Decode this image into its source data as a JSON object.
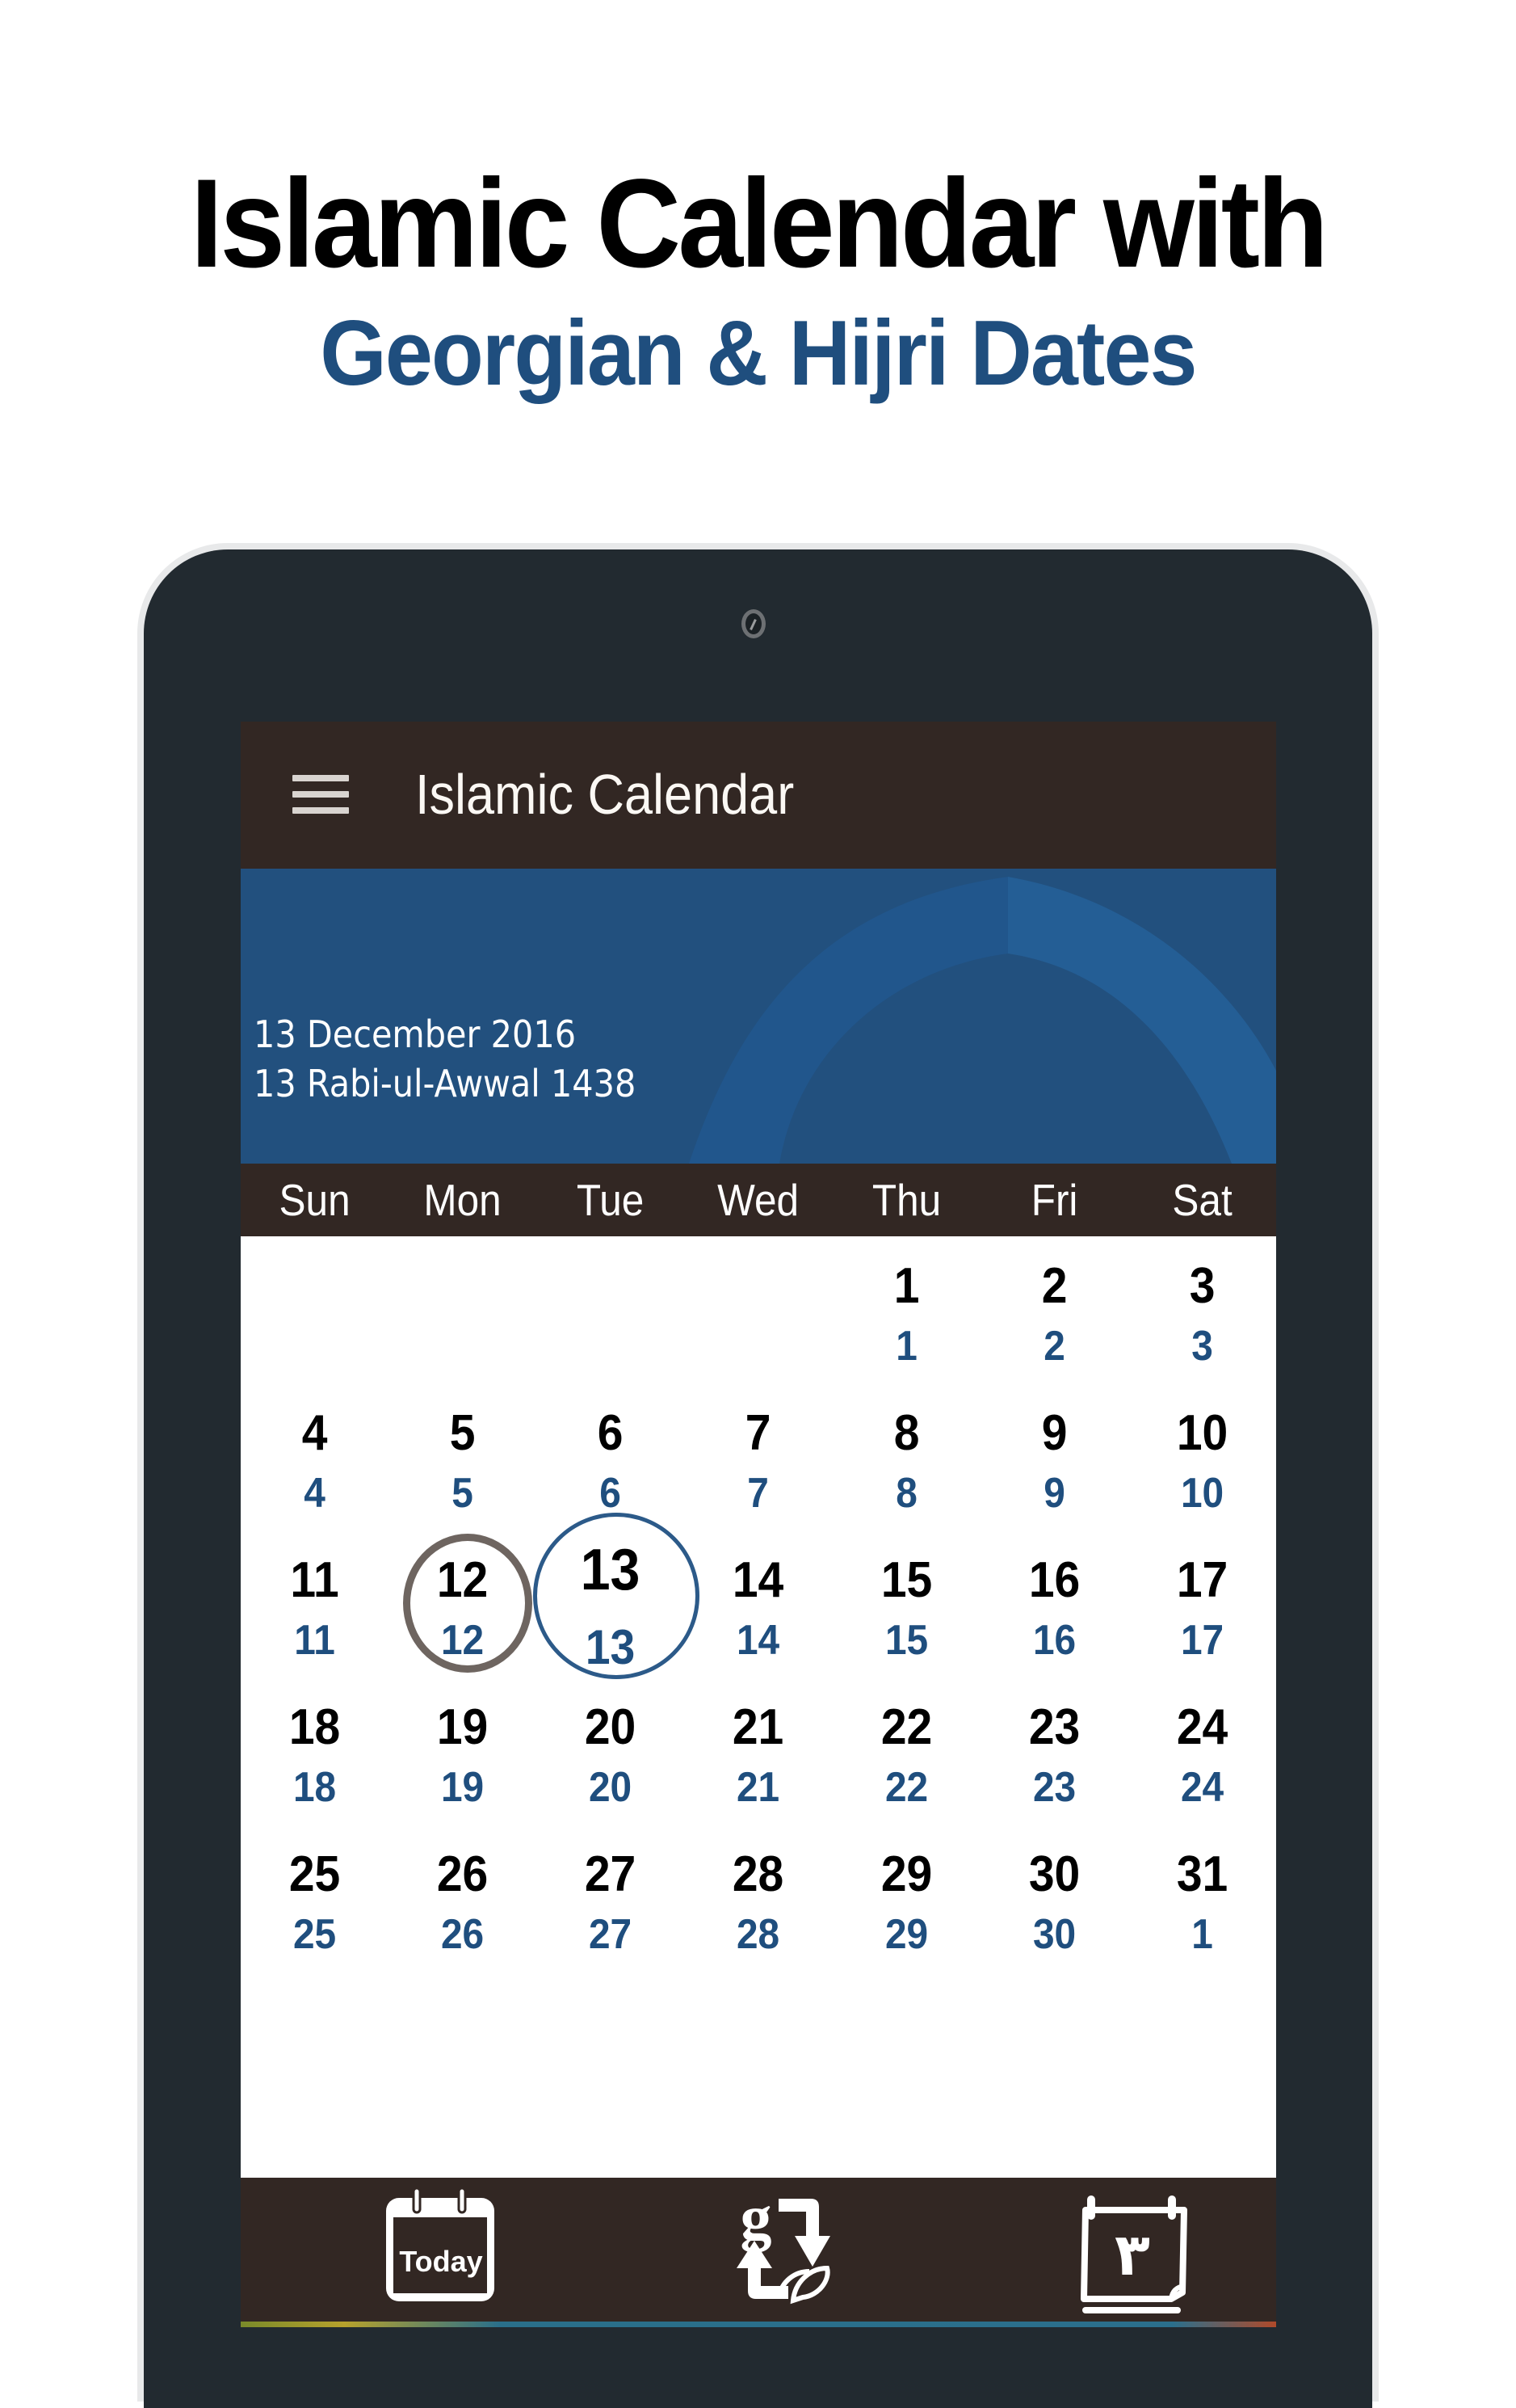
{
  "promo": {
    "headline": "Islamic Calendar with",
    "subheadline": "Georgian & Hijri Dates"
  },
  "app": {
    "title": "Islamic Calendar",
    "menu_icon": "hamburger-menu-icon"
  },
  "header": {
    "gregorian_date": "13 December 2016",
    "hijri_date": "13 Rabi-ul-Awwal 1438"
  },
  "calendar": {
    "weekdays": [
      "Sun",
      "Mon",
      "Tue",
      "Wed",
      "Thu",
      "Fri",
      "Sat"
    ],
    "today": {
      "gregorian": "13",
      "hijri": "13"
    },
    "selected": {
      "gregorian": "12",
      "hijri": "12"
    },
    "weeks": [
      [
        null,
        null,
        null,
        null,
        {
          "g": "1",
          "h": "1"
        },
        {
          "g": "2",
          "h": "2"
        },
        {
          "g": "3",
          "h": "3"
        }
      ],
      [
        {
          "g": "4",
          "h": "4"
        },
        {
          "g": "5",
          "h": "5"
        },
        {
          "g": "6",
          "h": "6"
        },
        {
          "g": "7",
          "h": "7"
        },
        {
          "g": "8",
          "h": "8"
        },
        {
          "g": "9",
          "h": "9"
        },
        {
          "g": "10",
          "h": "10"
        }
      ],
      [
        {
          "g": "11",
          "h": "11"
        },
        {
          "g": "12",
          "h": "12",
          "state": "selected"
        },
        {
          "g": "13",
          "h": "13",
          "state": "today"
        },
        {
          "g": "14",
          "h": "14"
        },
        {
          "g": "15",
          "h": "15"
        },
        {
          "g": "16",
          "h": "16"
        },
        {
          "g": "17",
          "h": "17"
        }
      ],
      [
        {
          "g": "18",
          "h": "18"
        },
        {
          "g": "19",
          "h": "19"
        },
        {
          "g": "20",
          "h": "20"
        },
        {
          "g": "21",
          "h": "21"
        },
        {
          "g": "22",
          "h": "22"
        },
        {
          "g": "23",
          "h": "23"
        },
        {
          "g": "24",
          "h": "24"
        }
      ],
      [
        {
          "g": "25",
          "h": "25"
        },
        {
          "g": "26",
          "h": "26"
        },
        {
          "g": "27",
          "h": "27"
        },
        {
          "g": "28",
          "h": "28"
        },
        {
          "g": "29",
          "h": "29"
        },
        {
          "g": "30",
          "h": "30"
        },
        {
          "g": "31",
          "h": "1"
        }
      ]
    ]
  },
  "bottom_nav": {
    "today_icon_text": "Today",
    "today_icon": "today-calendar-icon",
    "convert_icon": "date-converter-icon",
    "convert_icon_glyph": "g",
    "hijri_icon": "hijri-calendar-icon",
    "hijri_icon_glyph": "٣"
  },
  "colors": {
    "brand_blue": "#1f4e7e",
    "header_blue": "#22507e",
    "appbar_brown": "#322723",
    "bezel": "#222a30",
    "selected_ring": "#6e6560",
    "today_ring": "#2c5a89"
  }
}
